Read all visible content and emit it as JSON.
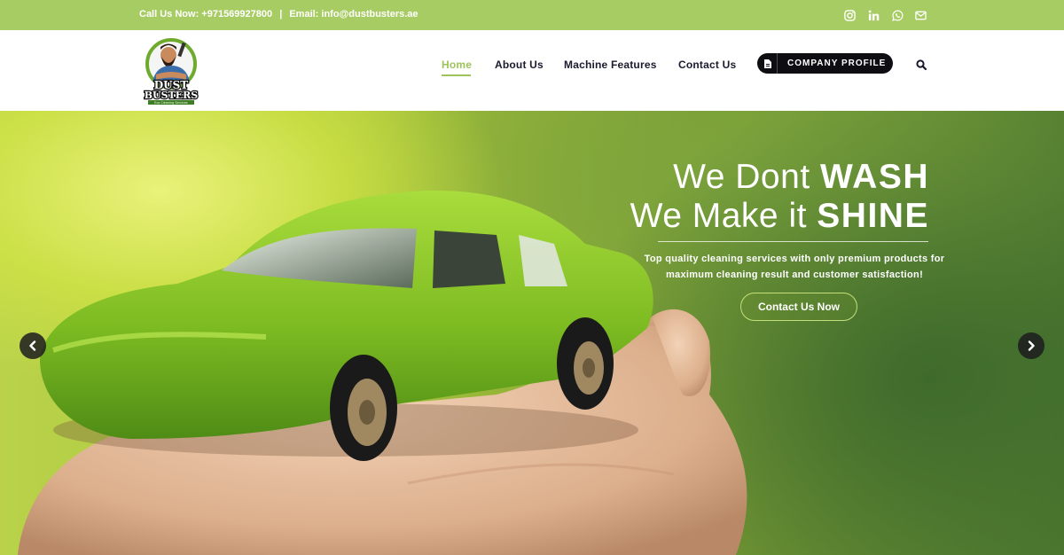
{
  "topbar": {
    "call_text": "Call Us Now: +971569927800",
    "separator": "|",
    "email_text": "Email: info@dustbusters.ae",
    "social": [
      "instagram-icon",
      "linkedin-icon",
      "whatsapp-icon",
      "mail-icon"
    ],
    "background_color": "#a8cc64"
  },
  "header": {
    "logo": {
      "line1": "DUST",
      "line2": "BUSTERS",
      "tagline": "Eco Cleaning Services"
    },
    "nav": [
      "Home",
      "About Us",
      "Machine Features",
      "Contact Us"
    ],
    "active_nav": "Home",
    "profile_button": "COMPANY PROFILE",
    "search_icon": "search-icon",
    "accent_color": "#9cc45a"
  },
  "hero": {
    "line1_light": "We Dont ",
    "line1_bold": "WASH",
    "line2_light": "We Make it ",
    "line2_bold": "SHINE",
    "tagline": "Top quality cleaning services with only premium products for maximum cleaning result and customer satisfaction!",
    "cta_label": "Contact Us Now",
    "prev_icon": "chevron-left-icon",
    "next_icon": "chevron-right-icon"
  }
}
